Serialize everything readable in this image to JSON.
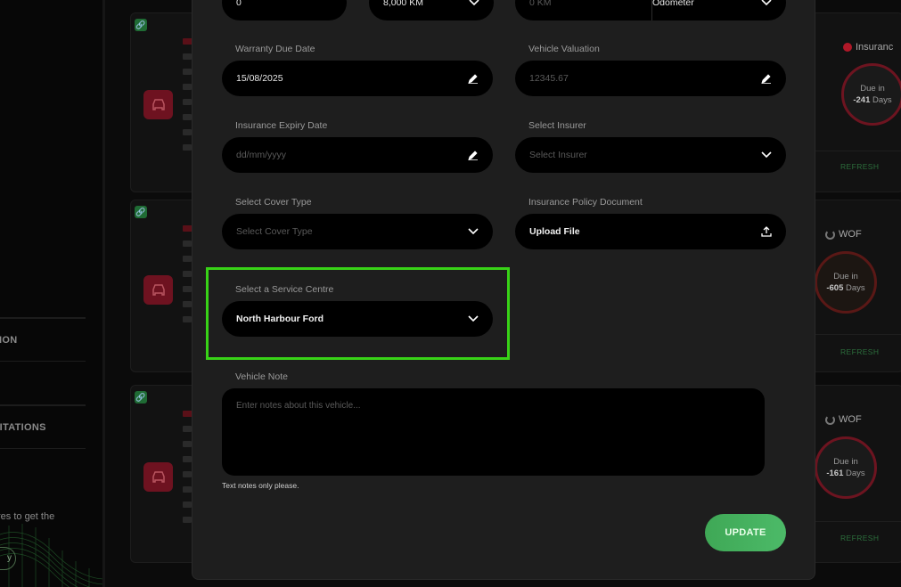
{
  "sidebar": {
    "items": [
      {
        "label": "TION"
      },
      {
        "label": "VITATIONS"
      }
    ],
    "promo_text": "res to get the",
    "promo_button": "y"
  },
  "cards": [
    {
      "due_label": "Insuranc",
      "due_prefix": "Due in",
      "due_days": "-241",
      "due_suffix": "Days",
      "refresh": "REFRESH"
    },
    {
      "due_label": "WOF",
      "due_prefix": "Due in",
      "due_days": "-605",
      "due_suffix": "Days",
      "refresh": "REFRESH"
    },
    {
      "due_label": "WOF",
      "due_prefix": "Due in",
      "due_days": "-161",
      "due_suffix": "Days",
      "refresh": "REFRESH"
    }
  ],
  "modal": {
    "top_row": {
      "field1_value": "0",
      "field2_value": "8,000 KM",
      "field3_placeholder": "0 KM",
      "field3_unit": "Odometer"
    },
    "warranty_due": {
      "label": "Warranty Due Date",
      "value": "15/08/2025"
    },
    "vehicle_valuation": {
      "label": "Vehicle Valuation",
      "placeholder": "12345.67"
    },
    "insurance_expiry": {
      "label": "Insurance Expiry Date",
      "placeholder": "dd/mm/yyyy"
    },
    "insurer": {
      "label": "Select Insurer",
      "placeholder": "Select Insurer"
    },
    "cover_type": {
      "label": "Select Cover Type",
      "placeholder": "Select Cover Type"
    },
    "policy_doc": {
      "label": "Insurance Policy Document",
      "button": "Upload File"
    },
    "service_centre": {
      "label": "Select a Service Centre",
      "value": "North Harbour Ford"
    },
    "vehicle_note": {
      "label": "Vehicle Note",
      "placeholder": "Enter notes about this vehicle...",
      "hint": "Text notes only please."
    },
    "update_button": "UPDATE"
  },
  "colors": {
    "accent_green": "#3fa856",
    "highlight": "#38d317",
    "alert_red": "#b01828"
  }
}
